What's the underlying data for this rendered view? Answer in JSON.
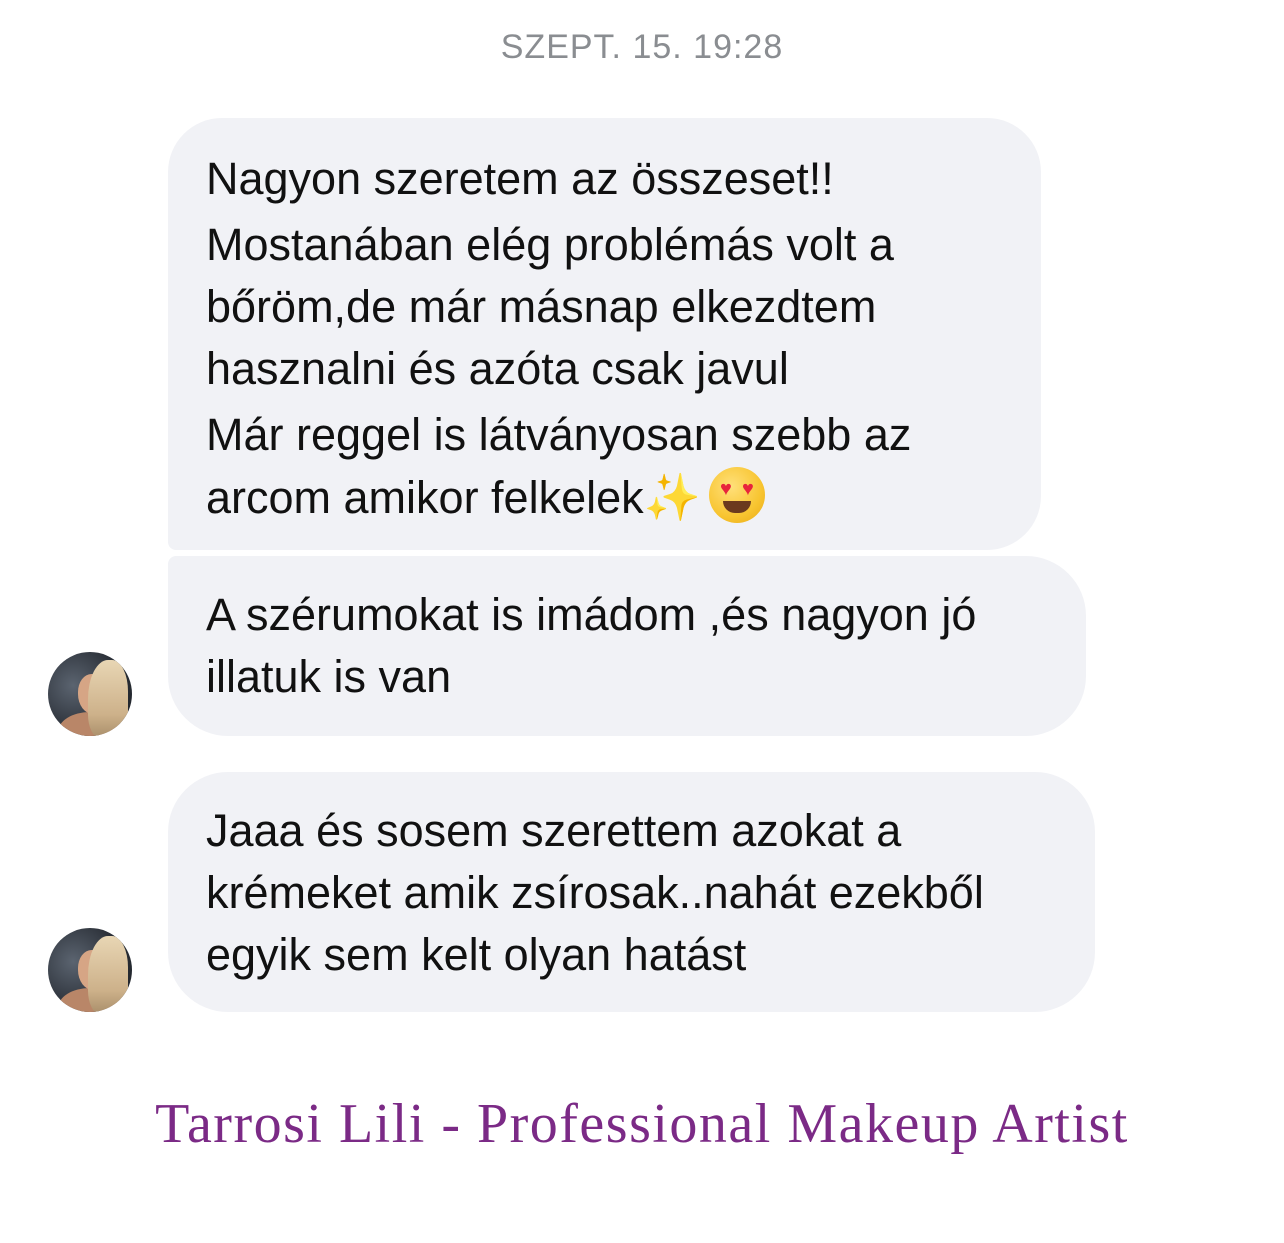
{
  "conversation": {
    "timestamp": "SZEPT. 15. 19:28",
    "messages": [
      {
        "lines": [
          "Nagyon szeretem az összeset!!",
          "Mostanában elég problémás volt a",
          "bőröm,de már másnap elkezdtem",
          "hasznalni és azóta csak javul",
          "Már reggel is látványosan szebb az",
          "arcom amikor felkelek"
        ],
        "emoji": [
          "sparkles",
          "heart-eyes"
        ]
      },
      {
        "lines": [
          "A szérumokat is imádom ,és nagyon jó",
          "illatuk is van"
        ]
      },
      {
        "lines": [
          "Jaaa és sosem szerettem azokat a",
          "krémeket amik zsírosak..nahát ezekből",
          "egyik sem kelt olyan hatást"
        ]
      }
    ]
  },
  "signature": "Tarrosi Lili - Professional Makeup Artist",
  "colors": {
    "bubble": "#f1f2f6",
    "timestamp": "#8a8d91",
    "signature": "#7b2a86"
  }
}
